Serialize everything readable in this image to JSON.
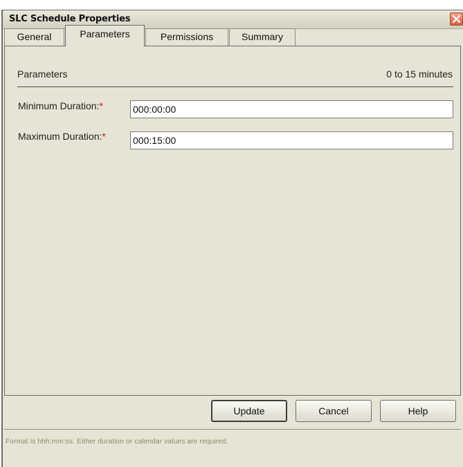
{
  "window": {
    "title": "SLC Schedule Properties",
    "close_icon": "close-icon"
  },
  "tabs": [
    {
      "label": "General",
      "active": false
    },
    {
      "label": "Parameters",
      "active": true
    },
    {
      "label": "Permissions",
      "active": false
    },
    {
      "label": "Summary",
      "active": false
    }
  ],
  "parameters": {
    "section_label": "Parameters",
    "range_text": "0 to 15 minutes",
    "min_duration": {
      "label": "Minimum Duration:",
      "required_mark": "*",
      "value": "000:00:00"
    },
    "max_duration": {
      "label": "Maximum Duration:",
      "required_mark": "*",
      "value": "000:15:00"
    }
  },
  "buttons": {
    "update": "Update",
    "cancel": "Cancel",
    "help": "Help"
  },
  "status": {
    "text": "Format is hhh:mm:ss. Either duration or calendar values are required."
  },
  "colors": {
    "background": "#e6e4d6",
    "required": "#dd1111",
    "status_text": "#8d8a61",
    "close_button": "#d8603f"
  }
}
